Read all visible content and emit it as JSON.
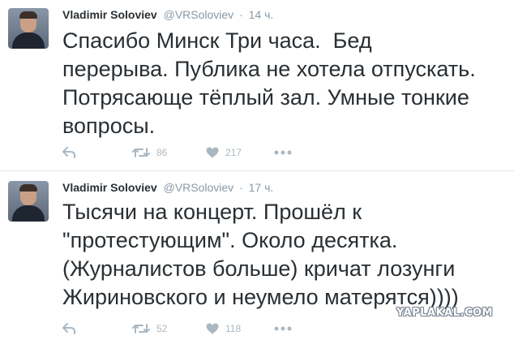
{
  "tweets": [
    {
      "author_name": "Vladimir Soloviev",
      "handle": "@VRSoloviev",
      "separator": "·",
      "time": "14 ч.",
      "text": "Спасибо Минск Три часа.  Бед\nперерыва. Публика не хотела отпускать.\nПотрясающе тёплый зал. Умные тонкие\nвопросы.",
      "retweets": "86",
      "likes": "217"
    },
    {
      "author_name": "Vladimir Soloviev",
      "handle": "@VRSoloviev",
      "separator": "·",
      "time": "17 ч.",
      "text": "Тысячи на концерт. Прошёл к\n\"протестующим\". Около десятка.\n(Журналистов больше) кричат лозунги\nЖириновского и неумело матерятся))))",
      "retweets": "52",
      "likes": "118"
    }
  ],
  "icons": {
    "reply": "reply-arrow-icon",
    "retweet": "retweet-icon",
    "like": "heart-icon",
    "more": "more-dots-icon"
  },
  "colors": {
    "text": "#292f33",
    "muted": "#8899a6",
    "action": "#aab8c2",
    "divider": "#e1e8ed"
  },
  "watermark": "YAPLAKAL.COM"
}
